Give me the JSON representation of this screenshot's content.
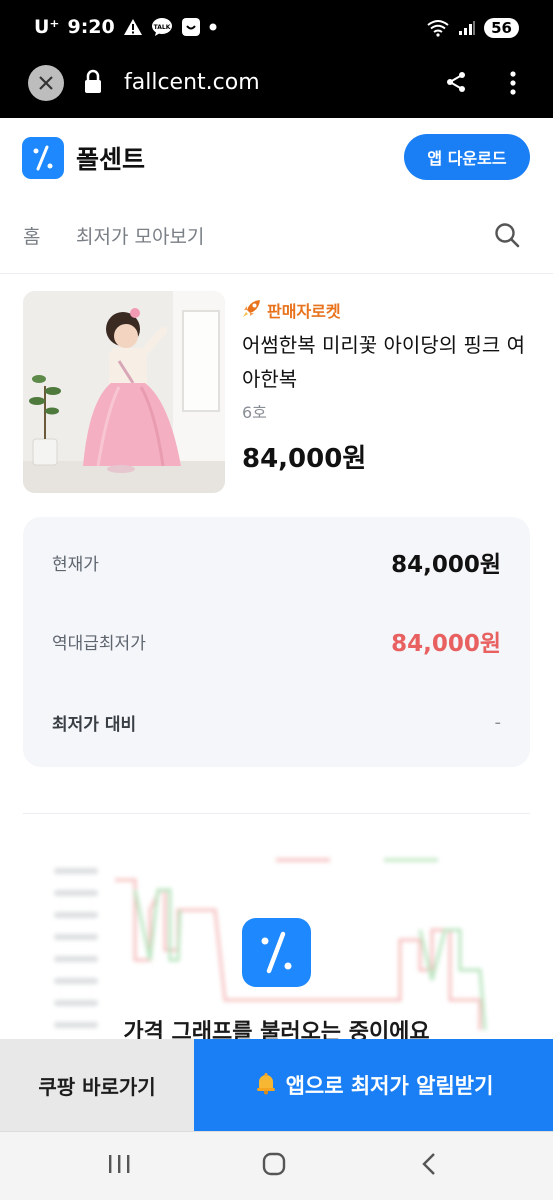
{
  "status_bar": {
    "carrier": "U⁺",
    "time": "9:20",
    "battery": "56"
  },
  "browser": {
    "url": "fallcent.com"
  },
  "header": {
    "brand": "폴센트",
    "app_download_label": "앱 다운로드"
  },
  "nav": {
    "items": [
      {
        "label": "홈"
      },
      {
        "label": "최저가 모아보기"
      }
    ]
  },
  "product": {
    "seller_badge": "판매자로켓",
    "title": "어썸한복 미리꽃 아이당의 핑크 여아한복",
    "option": "6호",
    "price": "84,000원"
  },
  "price_info": {
    "rows": [
      {
        "label": "현재가",
        "value": "84,000원"
      },
      {
        "label": "역대급최저가",
        "value": "84,000원"
      },
      {
        "label": "최저가 대비",
        "value": "-"
      }
    ]
  },
  "chart_loading": {
    "message": "가격 그래프를 불러오는 중이에요"
  },
  "cta": {
    "coupang_label": "쿠팡 바로가기",
    "alert_label": "앱으로 최저가 알림받기"
  },
  "colors": {
    "brand_blue": "#1a7ff5",
    "seller_orange": "#e8731c",
    "lowest_price_red": "#e86060"
  }
}
